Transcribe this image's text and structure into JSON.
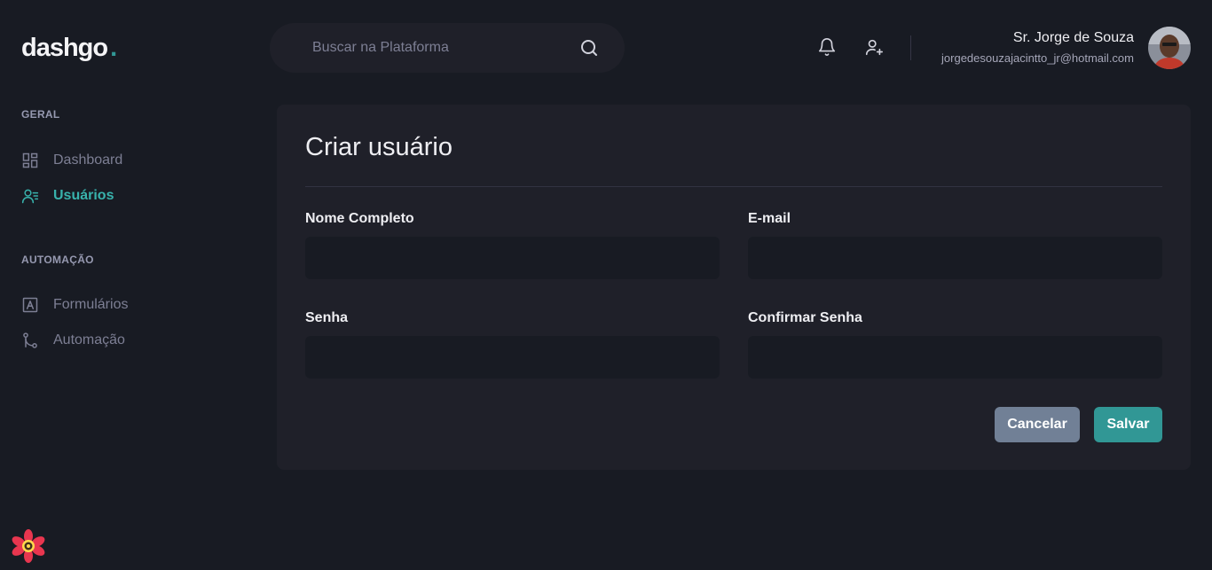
{
  "header": {
    "logo_text": "dashgo",
    "logo_dot": ".",
    "search": {
      "placeholder": "Buscar na Plataforma",
      "value": ""
    },
    "icons": [
      "bell-icon",
      "user-add-icon"
    ],
    "profile": {
      "name": "Sr. Jorge de Souza",
      "email": "jorgedesouzajacintto_jr@hotmail.com"
    }
  },
  "sidebar": {
    "sections": [
      {
        "title": "GERAL",
        "items": [
          {
            "label": "Dashboard",
            "icon": "dashboard-icon",
            "active": false
          },
          {
            "label": "Usuários",
            "icon": "users-icon",
            "active": true
          }
        ]
      },
      {
        "title": "AUTOMAÇÃO",
        "items": [
          {
            "label": "Formulários",
            "icon": "form-icon",
            "active": false
          },
          {
            "label": "Automação",
            "icon": "git-merge-icon",
            "active": false
          }
        ]
      }
    ]
  },
  "form": {
    "title": "Criar usuário",
    "fields": [
      {
        "label": "Nome Completo",
        "value": "",
        "type": "text"
      },
      {
        "label": "E-mail",
        "value": "",
        "type": "email"
      },
      {
        "label": "Senha",
        "value": "",
        "type": "password"
      },
      {
        "label": "Confirmar Senha",
        "value": "",
        "type": "password"
      }
    ],
    "cancel_label": "Cancelar",
    "save_label": "Salvar"
  },
  "colors": {
    "background": "#181b23",
    "panel": "#1f2029",
    "accent": "#319795",
    "accent_text": "#38b2ac",
    "cancel": "#718096",
    "muted_text": "#7d7f94"
  }
}
